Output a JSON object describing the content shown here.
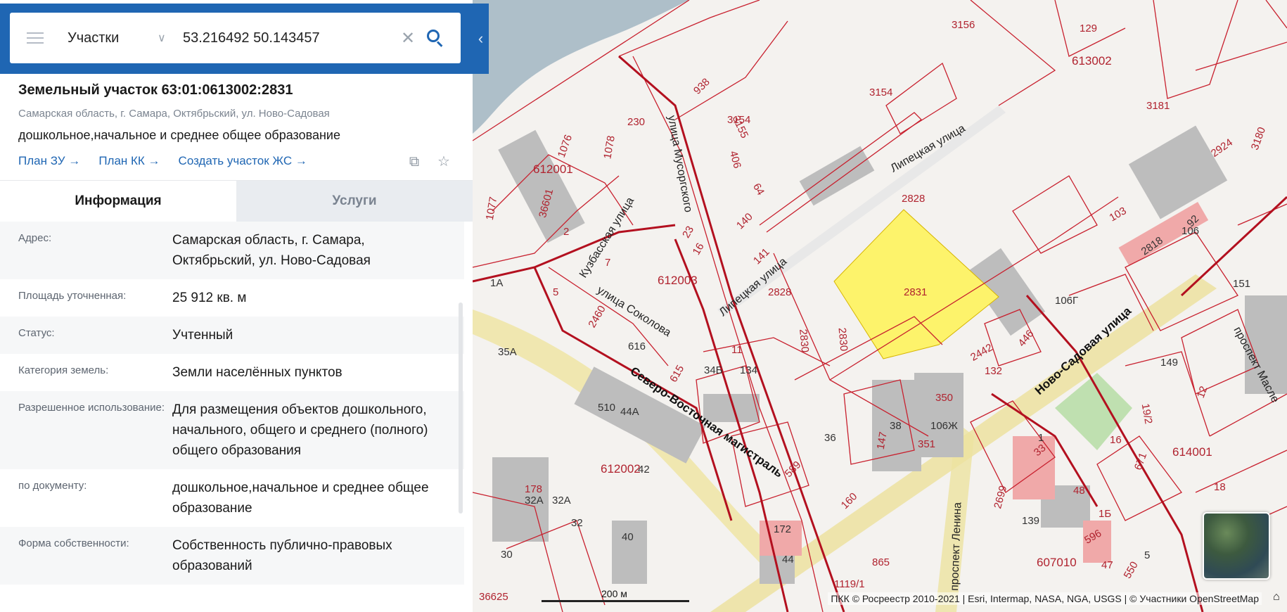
{
  "search": {
    "layer": "Участки",
    "query": "53.216492 50.143457"
  },
  "parcel": {
    "title": "Земельный участок 63:01:0613002:2831",
    "address_short": "Самарская область, г. Самара, Октябрьский, ул. Ново-Садовая",
    "purpose_short": "дошкольное,начальное и среднее общее образование",
    "links": [
      "План ЗУ →",
      "План КК →",
      "Создать участок ЖС →"
    ]
  },
  "tabs": {
    "info": "Информация",
    "services": "Услуги"
  },
  "info_rows": [
    {
      "key": "Адрес:",
      "value": "Самарская область, г. Самара, Октябрьский, ул. Ново-Садовая"
    },
    {
      "key": "Площадь уточненная:",
      "value": "25 912 кв. м"
    },
    {
      "key": "Статус:",
      "value": "Учтенный"
    },
    {
      "key": "Категория земель:",
      "value": "Земли населённых пунктов"
    },
    {
      "key": "Разрешенное использование:",
      "value": "Для размещения объектов дошкольного, начального, общего и среднего (полного) общего образования"
    },
    {
      "key": "по документу:",
      "value": "дошкольное,начальное и среднее общее образование"
    },
    {
      "key": "Форма собственности:",
      "value": "Собственность публично-правовых образований"
    }
  ],
  "map": {
    "selected_parcel_label": "2831",
    "selected_color": "#fdf36b",
    "boundary_color": "#c8202e",
    "streets": [
      "улица Мусоргского",
      "Липецкая улица",
      "Кузбасская улица",
      "улица Соколова",
      "Северо-Восточная магистраль",
      "Ново-Садовая улица",
      "проспект Ленина",
      "проспект Масле"
    ],
    "quarters": [
      "613002",
      "612001",
      "612003",
      "612002",
      "614001",
      "607010"
    ],
    "parcel_labels": [
      "3156",
      "3154",
      "3155",
      "3181",
      "129",
      "938",
      "230",
      "406",
      "1076",
      "1078",
      "36601",
      "1077",
      "64",
      "140",
      "141",
      "23",
      "16",
      "7",
      "2",
      "5",
      "1А",
      "2460",
      "616",
      "615",
      "34Б",
      "134",
      "11",
      "2828",
      "2830",
      "2442",
      "132",
      "446",
      "106Г",
      "106",
      "103",
      "151",
      "149",
      "12",
      "19/2",
      "16",
      "671",
      "614001",
      "18",
      "1",
      "33",
      "48",
      "1Б",
      "5",
      "47",
      "550",
      "139",
      "2699",
      "596",
      "865",
      "1119/1",
      "172",
      "44",
      "36",
      "147",
      "38",
      "350",
      "106Ж",
      "351",
      "589",
      "160",
      "510",
      "44А",
      "42",
      "178",
      "32А",
      "32",
      "40",
      "35А",
      "30",
      "36625",
      "3180",
      "2924",
      "2818",
      "92"
    ],
    "scale_label": "200 м",
    "attribution": "ПКК © Росреестр 2010-2021 | Esri, Intermap, NASA, NGA, USGS | © Участники OpenStreetMap"
  }
}
